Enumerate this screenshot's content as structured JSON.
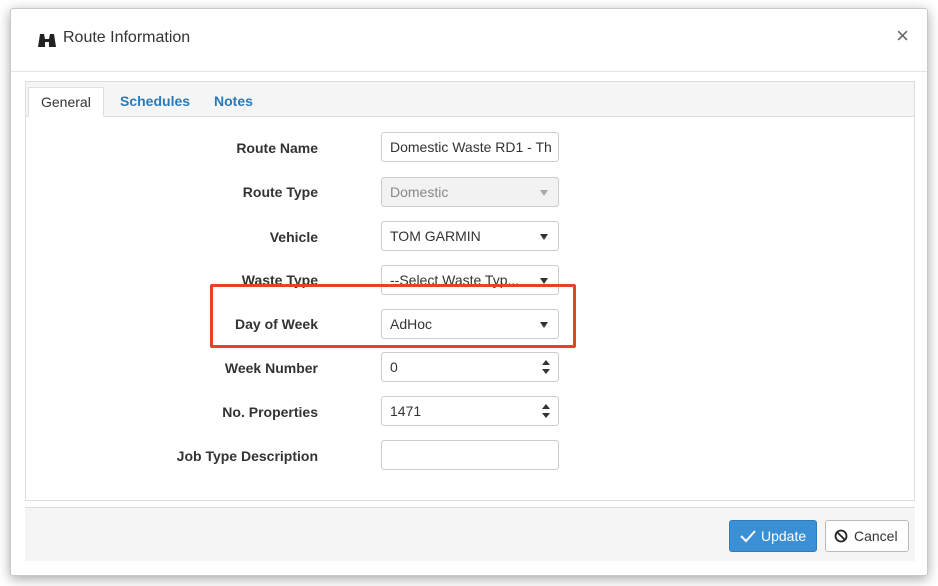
{
  "dialog": {
    "title": "Route Information",
    "close_label": "×"
  },
  "tabs": [
    {
      "label": "General",
      "active": true
    },
    {
      "label": "Schedules",
      "active": false
    },
    {
      "label": "Notes",
      "active": false
    }
  ],
  "form": {
    "route_name": {
      "label": "Route Name",
      "value": "Domestic Waste RD1 - Th"
    },
    "route_type": {
      "label": "Route Type",
      "value": "Domestic",
      "disabled": true
    },
    "vehicle": {
      "label": "Vehicle",
      "value": "TOM GARMIN"
    },
    "waste_type": {
      "label": "Waste Type",
      "value": "--Select Waste Typ..."
    },
    "day_of_week": {
      "label": "Day of Week",
      "value": "AdHoc"
    },
    "week_number": {
      "label": "Week Number",
      "value": "0"
    },
    "no_properties": {
      "label": "No. Properties",
      "value": "1471"
    },
    "job_type_description": {
      "label": "Job Type Description",
      "value": ""
    }
  },
  "footer": {
    "update_label": "Update",
    "cancel_label": "Cancel"
  },
  "colors": {
    "accent": "#3b8fd4",
    "highlight": "#e8412b",
    "tab_link": "#2a7ab8"
  },
  "icons": {
    "title": "binoculars-icon",
    "update": "checkmark-icon",
    "cancel": "prohibited-icon"
  }
}
